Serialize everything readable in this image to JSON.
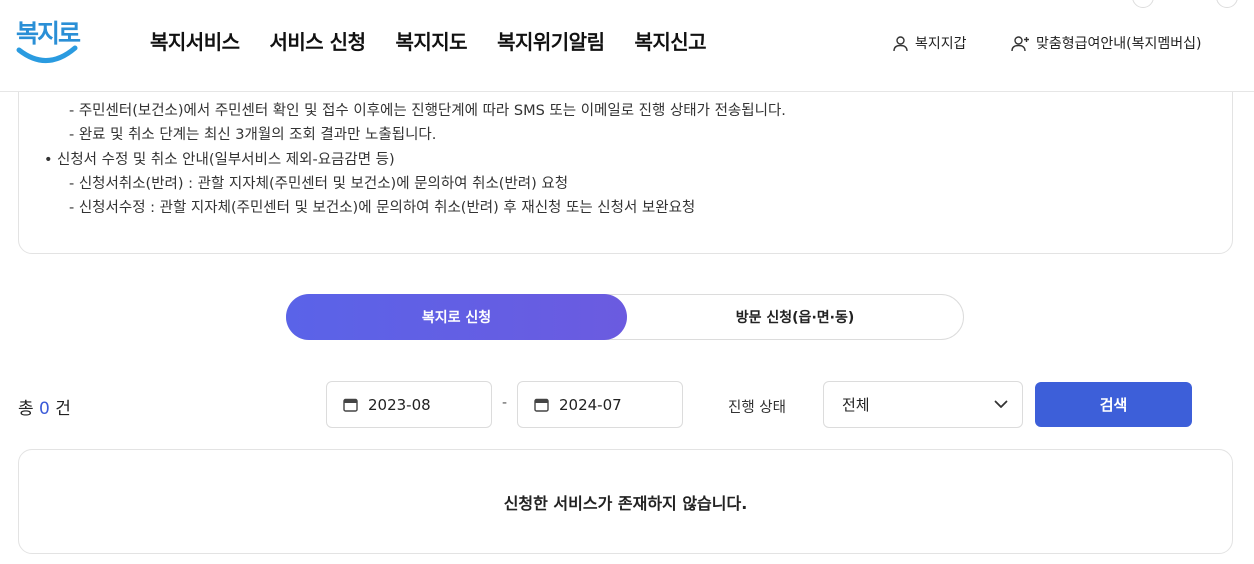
{
  "logo": {
    "text": "복지로",
    "accent_color": "#2a8fd6"
  },
  "nav": {
    "items": [
      {
        "label": "복지서비스"
      },
      {
        "label": "서비스 신청"
      },
      {
        "label": "복지지도"
      },
      {
        "label": "복지위기알림"
      },
      {
        "label": "복지신고"
      }
    ]
  },
  "utility": {
    "wallet": {
      "label": "복지지갑",
      "icon": "person-icon"
    },
    "custom": {
      "label": "맞춤형급여안내(복지멤버십)",
      "icon": "person-add-icon"
    }
  },
  "notice": {
    "lines": [
      {
        "text": "- 주민센터(보건소)에서 주민센터 확인 및 접수 이후에는 진행단계에 따라 SMS 또는 이메일로 진행 상태가 전송됩니다."
      },
      {
        "text": "- 완료 및 취소 단계는 최신 3개월의 조회 결과만 노출됩니다."
      },
      {
        "text": "신청서 수정 및 취소 안내(일부서비스 제외-요금감면 등)"
      },
      {
        "text": "- 신청서취소(반려) : 관할 지자체(주민센터 및 보건소)에 문의하여 취소(반려) 요청"
      },
      {
        "text": "- 신청서수정 : 관할 지자체(주민센터 및 보건소)에 문의하여 취소(반려) 후 재신청 또는 신청서 보완요청"
      }
    ]
  },
  "toggle": {
    "active_label": "복지로 신청",
    "inactive_label": "방문 신청(읍·면·동)",
    "active_color": "#5a63e8"
  },
  "search": {
    "total_prefix": "총",
    "total_count": "0",
    "total_suffix": "건",
    "date_from": "2023-08",
    "date_separator": "-",
    "date_to": "2024-07",
    "status_label": "진행 상태",
    "status_value": "전체",
    "button_label": "검색",
    "button_color": "#3d5fd9",
    "icons": {
      "date": "calendar-icon",
      "select": "chevron-down-icon"
    }
  },
  "result": {
    "message": "신청한 서비스가 존재하지 않습니다."
  }
}
